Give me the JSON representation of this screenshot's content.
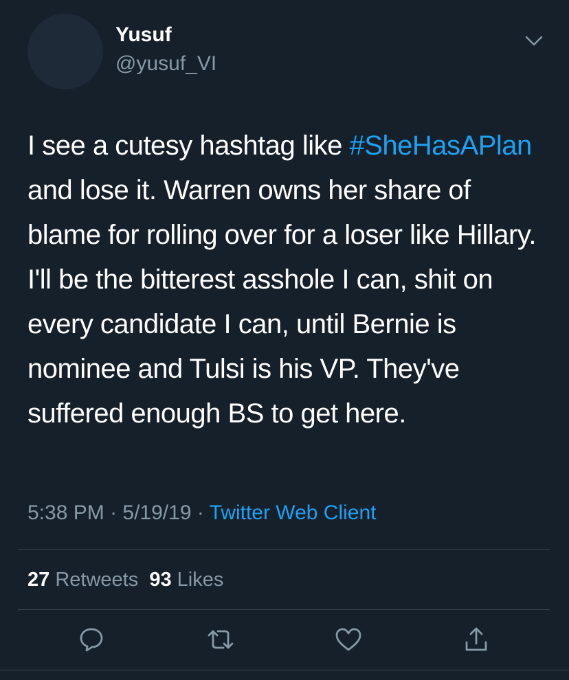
{
  "user": {
    "display_name": "Yusuf",
    "handle": "@yusuf_VI"
  },
  "tweet": {
    "text_before": "I see a cutesy hashtag like ",
    "hashtag": "#SheHasAPlan",
    "text_after": " and lose it. Warren owns her share of blame for rolling over for a loser like Hillary. I'll be the bitterest asshole I can, shit on every candidate I can, until Bernie is nominee and Tulsi is his VP. They've suffered enough BS to get here."
  },
  "meta": {
    "time": "5:38 PM",
    "sep1": " · ",
    "date": "5/19/19",
    "sep2": " · ",
    "source": "Twitter Web Client"
  },
  "stats": {
    "retweets_count": "27",
    "retweets_label": "Retweets",
    "likes_count": "93",
    "likes_label": "Likes"
  },
  "icons": {
    "menu": "chevron-down-icon",
    "reply": "reply-icon",
    "retweet": "retweet-icon",
    "like": "heart-icon",
    "share": "share-icon"
  },
  "colors": {
    "background": "#15202b",
    "accent": "#1da1f2",
    "secondary_text": "#8899a6",
    "divider": "#38444d"
  }
}
